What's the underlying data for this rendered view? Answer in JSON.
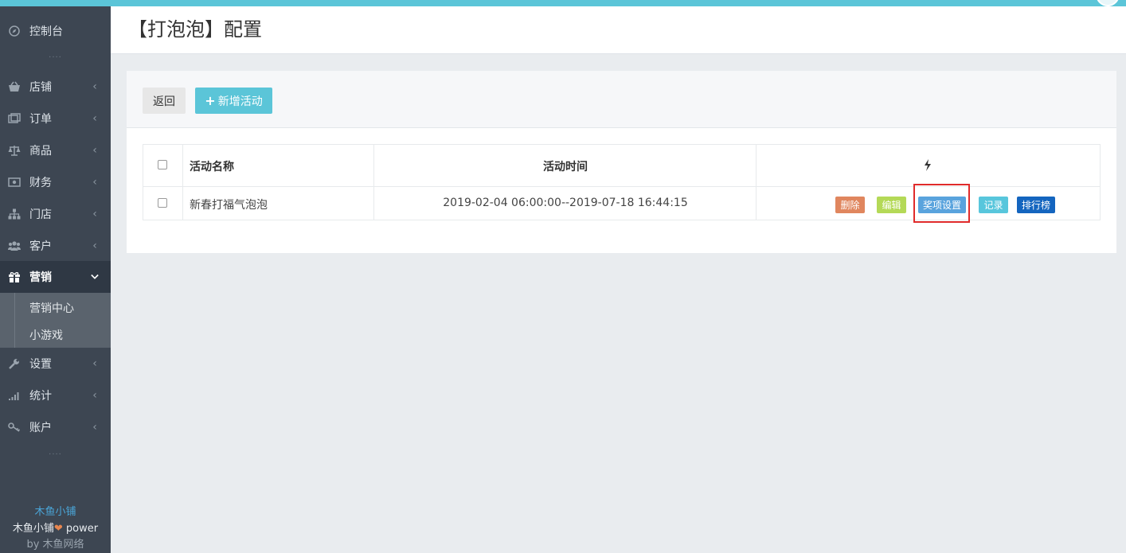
{
  "page": {
    "title": "【打泡泡】配置"
  },
  "sidebar": {
    "items": [
      {
        "label": "控制台",
        "icon": "compass-icon"
      },
      {
        "label": "店铺",
        "icon": "basket-icon"
      },
      {
        "label": "订单",
        "icon": "orders-icon"
      },
      {
        "label": "商品",
        "icon": "scale-icon"
      },
      {
        "label": "财务",
        "icon": "money-icon"
      },
      {
        "label": "门店",
        "icon": "sitemap-icon"
      },
      {
        "label": "客户",
        "icon": "users-icon"
      },
      {
        "label": "营销",
        "icon": "gift-icon",
        "active": true
      },
      {
        "label": "设置",
        "icon": "wrench-icon"
      },
      {
        "label": "统计",
        "icon": "signal-icon"
      },
      {
        "label": "账户",
        "icon": "key-icon"
      }
    ],
    "subitems": [
      "营销中心",
      "小游戏"
    ],
    "dots": "....",
    "footer": {
      "brand": "木鱼小铺",
      "power_prefix": "木鱼小铺",
      "power_suffix": " power",
      "by": "by 木鱼网络"
    }
  },
  "toolbar": {
    "back_label": "返回",
    "new_label": "新增活动"
  },
  "table": {
    "headers": {
      "name": "活动名称",
      "time": "活动时间",
      "actions_icon": "bolt-icon"
    },
    "rows": [
      {
        "name": "新春打福气泡泡",
        "time": "2019-02-04 06:00:00--2019-07-18 16:44:15"
      }
    ],
    "actions": {
      "delete": "删除",
      "edit": "编辑",
      "prize": "奖项设置",
      "log": "记录",
      "rank": "排行榜"
    }
  },
  "colors": {
    "accent": "#5bc5d8",
    "sidebar_bg": "#3d4652",
    "highlight": "#e02b2b"
  }
}
